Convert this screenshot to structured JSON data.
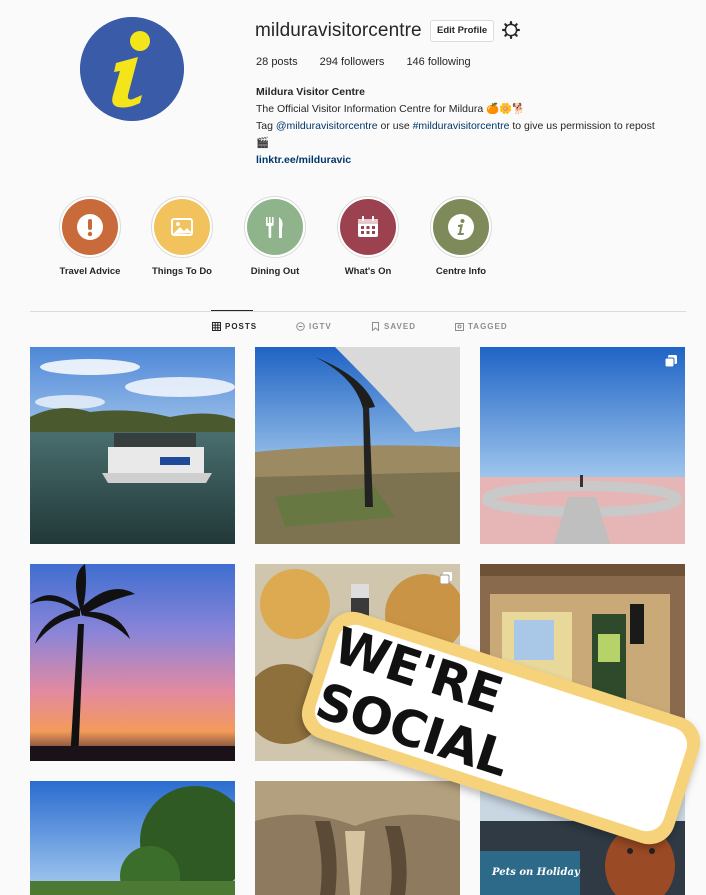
{
  "profile": {
    "username": "milduravisitorcentre",
    "edit_label": "Edit Profile",
    "posts": "28",
    "posts_label": "posts",
    "followers": "294",
    "followers_label": "followers",
    "following": "146",
    "following_label": "following",
    "display_name": "Mildura Visitor Centre",
    "bio_line1": "The Official Visitor Information Centre for Mildura 🍊🌼🐕",
    "bio_tag_prefix": "Tag ",
    "bio_mention": "@milduravisitorcentre",
    "bio_or": " or use ",
    "bio_hashtag": "#milduravisitorcentre",
    "bio_suffix": " to give us permission to repost",
    "bio_emoji": "🎬",
    "link": "linktr.ee/milduravic"
  },
  "highlights": [
    {
      "label": "Travel Advice",
      "icon": "exclamation-icon",
      "color": "#c96a3a"
    },
    {
      "label": "Things To Do",
      "icon": "image-icon",
      "color": "#f2c25d"
    },
    {
      "label": "Dining Out",
      "icon": "fork-knife-icon",
      "color": "#8fb48c"
    },
    {
      "label": "What's On",
      "icon": "calendar-icon",
      "color": "#9b4150"
    },
    {
      "label": "Centre Info",
      "icon": "info-icon",
      "color": "#7f8a5a"
    }
  ],
  "tabs": [
    {
      "label": "POSTS",
      "icon": "grid-icon"
    },
    {
      "label": "IGTV",
      "icon": "tv-icon"
    },
    {
      "label": "SAVED",
      "icon": "bookmark-icon"
    },
    {
      "label": "TAGGED",
      "icon": "tag-icon"
    }
  ],
  "sticker_text": "WE'RE SOCIAL",
  "post_caption": "Pets on Holiday",
  "colors": {
    "link": "#00376b",
    "accent": "#3a5ba8",
    "sticker": "#f6d27a"
  }
}
